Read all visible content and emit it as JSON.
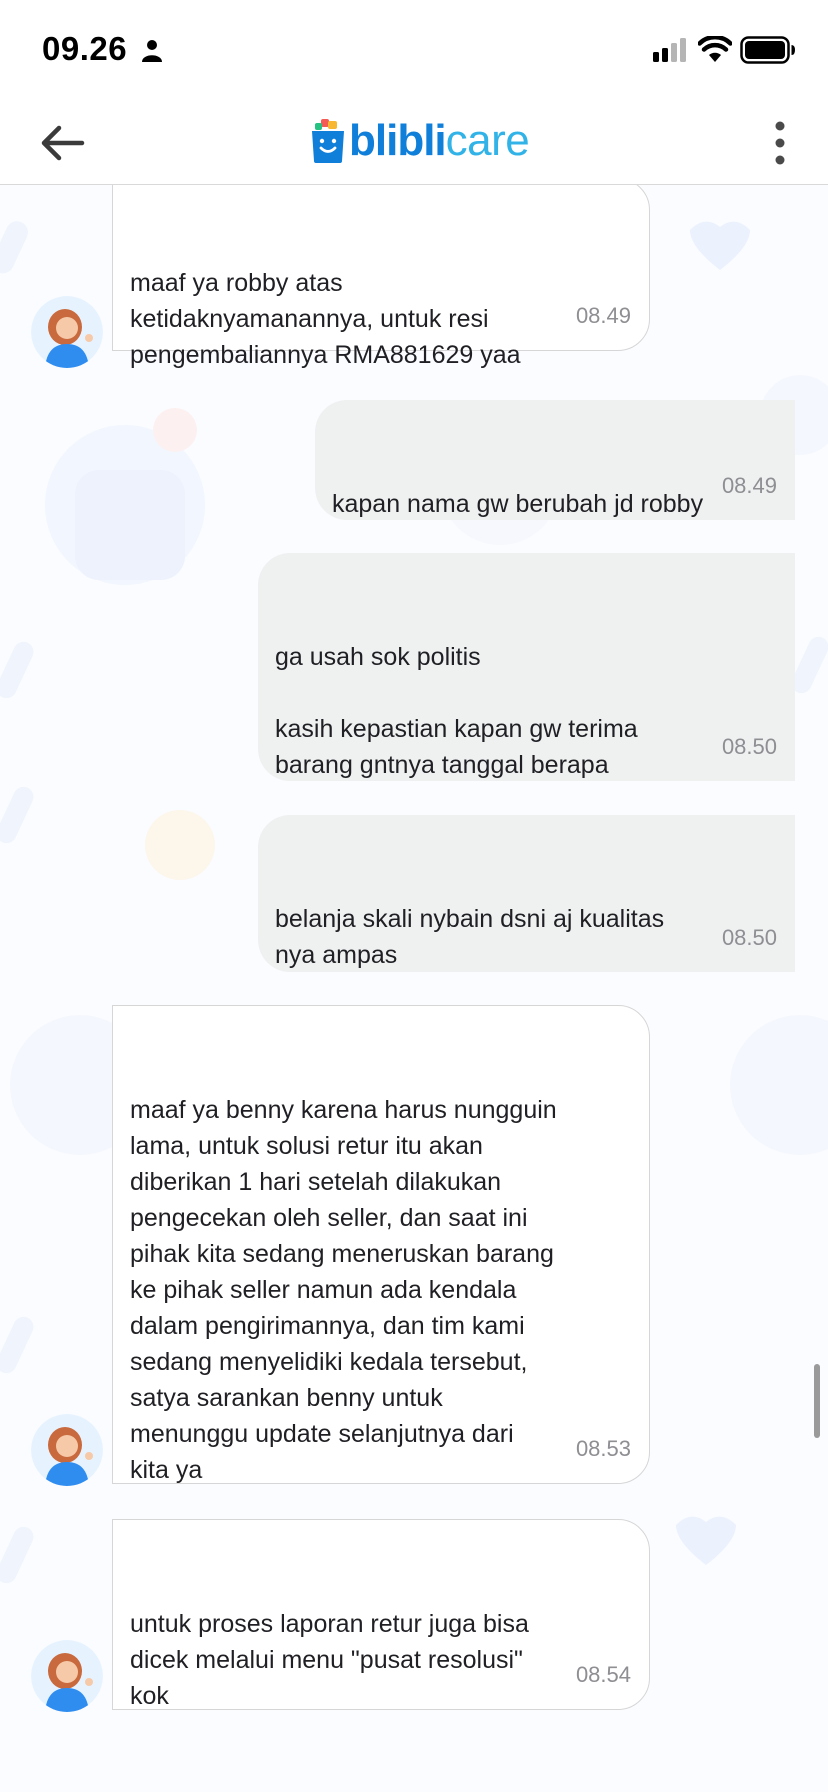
{
  "status_bar": {
    "time": "09.26",
    "icons": [
      "person-icon",
      "signal-icon",
      "wifi-icon",
      "battery-icon"
    ]
  },
  "header": {
    "brand_primary": "blibli",
    "brand_secondary": "care",
    "back_icon": "arrow-left-icon",
    "menu_icon": "more-vertical-icon"
  },
  "colors": {
    "brand_blue": "#0f7fd9",
    "brand_light_blue": "#31b3e7",
    "incoming_bubble": "#ffffff",
    "outgoing_bubble": "#eff1f1",
    "timestamp": "#8e8e93"
  },
  "messages": [
    {
      "from": "agent",
      "text": "maaf ya robby atas\nketidaknyamanannya, untuk resi\npengembaliannya RMA881629 yaa",
      "time": "08.49"
    },
    {
      "from": "user",
      "text": "kapan nama gw berubah jd robby",
      "time": "08.49"
    },
    {
      "from": "user",
      "text": "ga usah sok politis\n\nkasih kepastian kapan gw terima\nbarang gntnya tanggal berapa",
      "time": "08.50"
    },
    {
      "from": "user",
      "text": "belanja skali nybain dsni aj kualitas\nnya ampas",
      "time": "08.50"
    },
    {
      "from": "agent",
      "text": "maaf ya benny karena harus nungguin\nlama, untuk solusi retur itu akan\ndiberikan 1 hari setelah dilakukan\npengecekan oleh seller, dan saat ini\npihak kita sedang meneruskan barang\nke pihak seller namun ada kendala\ndalam pengirimannya, dan tim kami\nsedang menyelidiki kedala tersebut,\nsatya sarankan benny untuk\nmenunggu update selanjutnya dari\nkita ya",
      "time": "08.53"
    },
    {
      "from": "agent",
      "text": "untuk proses laporan retur juga bisa\ndicek melalui menu \"pusat resolusi\"\nkok",
      "time": "08.54"
    }
  ]
}
